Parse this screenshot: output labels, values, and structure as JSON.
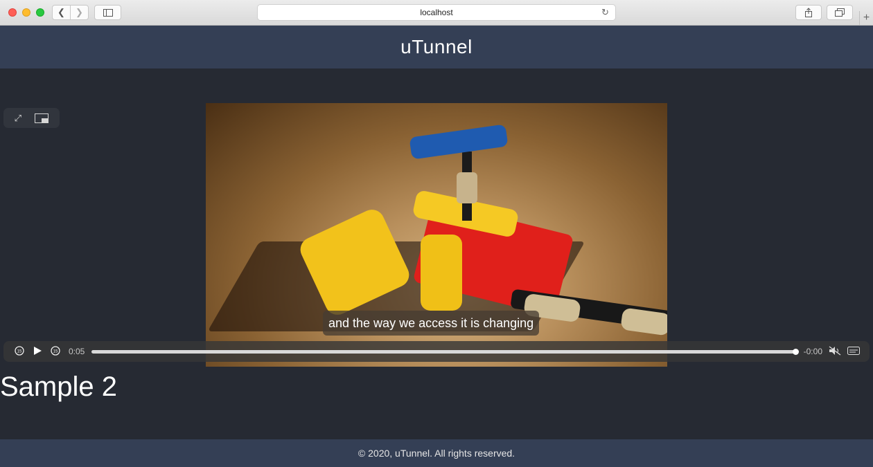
{
  "browser": {
    "url": "localhost",
    "back_icon": "chevron-left-icon",
    "forward_icon": "chevron-right-icon",
    "sidebar_icon": "sidebar-icon",
    "reload_icon": "reload-icon",
    "share_icon": "share-icon",
    "tabs_icon": "tabs-icon",
    "newtab_icon": "plus-icon"
  },
  "header": {
    "title": "uTunnel"
  },
  "video": {
    "caption": "and the way we access it is changing",
    "pip_controls": [
      "fullscreen-icon",
      "picture-in-picture-icon"
    ],
    "controls": {
      "current_time": "0:05",
      "remaining_time": "-0:00",
      "progress": 1.0,
      "icons": [
        "skip-back-15-icon",
        "play-icon",
        "skip-forward-15-icon",
        "mute-icon",
        "captions-icon"
      ]
    }
  },
  "main": {
    "sample_title": "Sample 2"
  },
  "footer": {
    "text": "© 2020, uTunnel. All rights reserved."
  }
}
